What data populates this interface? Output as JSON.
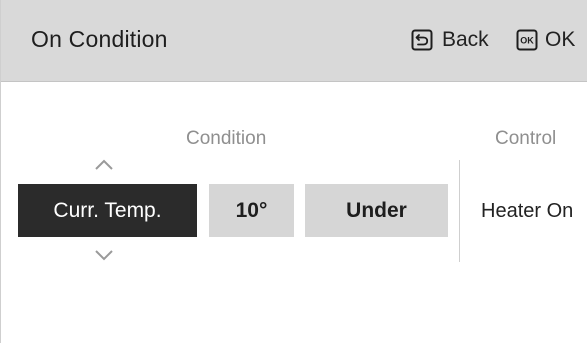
{
  "header": {
    "title": "On Condition",
    "back_label": "Back",
    "ok_label": "OK",
    "back_icon": "return-arrow-icon",
    "ok_icon": "ok-box-icon"
  },
  "condition": {
    "heading": "Condition",
    "selected_item": "Curr. Temp.",
    "value": "10°",
    "operator": "Under"
  },
  "control": {
    "heading": "Control",
    "value": "Heater On"
  },
  "colors": {
    "header_bg": "#d9d9d9",
    "selected_bg": "#2b2b2b",
    "cell_bg": "#d6d6d6",
    "heading_text": "#8f8f8f"
  }
}
